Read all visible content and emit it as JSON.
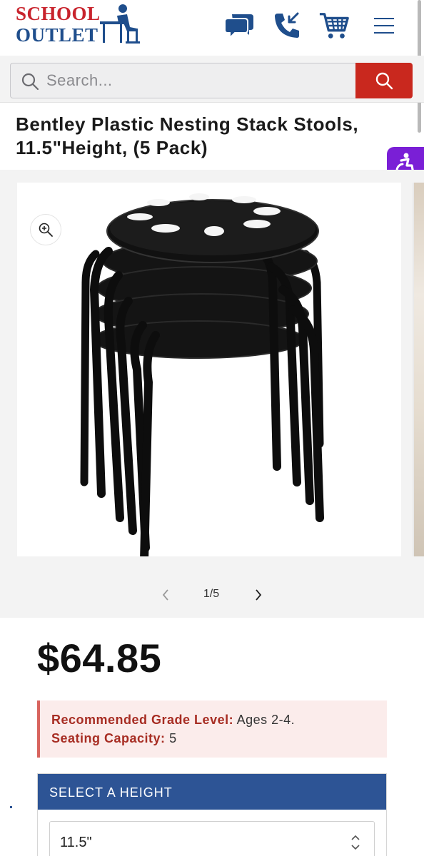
{
  "header": {
    "logo_line1": "SCHOOL",
    "logo_line2": "OUTLET",
    "icons": [
      "chat-icon",
      "phone-icon",
      "cart-icon",
      "menu-icon"
    ]
  },
  "search": {
    "placeholder": "Search..."
  },
  "product": {
    "title": "Bentley Plastic Nesting Stack Stools, 11.5\"Height, (5 Pack)",
    "price": "$64.85",
    "gallery": {
      "current": "1/5"
    },
    "notice": {
      "grade_label": "Recommended Grade Level:",
      "grade_value": "Ages 2-4.",
      "capacity_label": "Seating Capacity:",
      "capacity_value": "5"
    },
    "height_selector": {
      "heading": "SELECT A HEIGHT",
      "selected": "11.5\""
    }
  },
  "colors": {
    "brand_red": "#c8232c",
    "brand_blue": "#1f4e8c",
    "search_button": "#c9281e",
    "accessibility": "#7a1fd6",
    "selector_header": "#2d5495"
  }
}
